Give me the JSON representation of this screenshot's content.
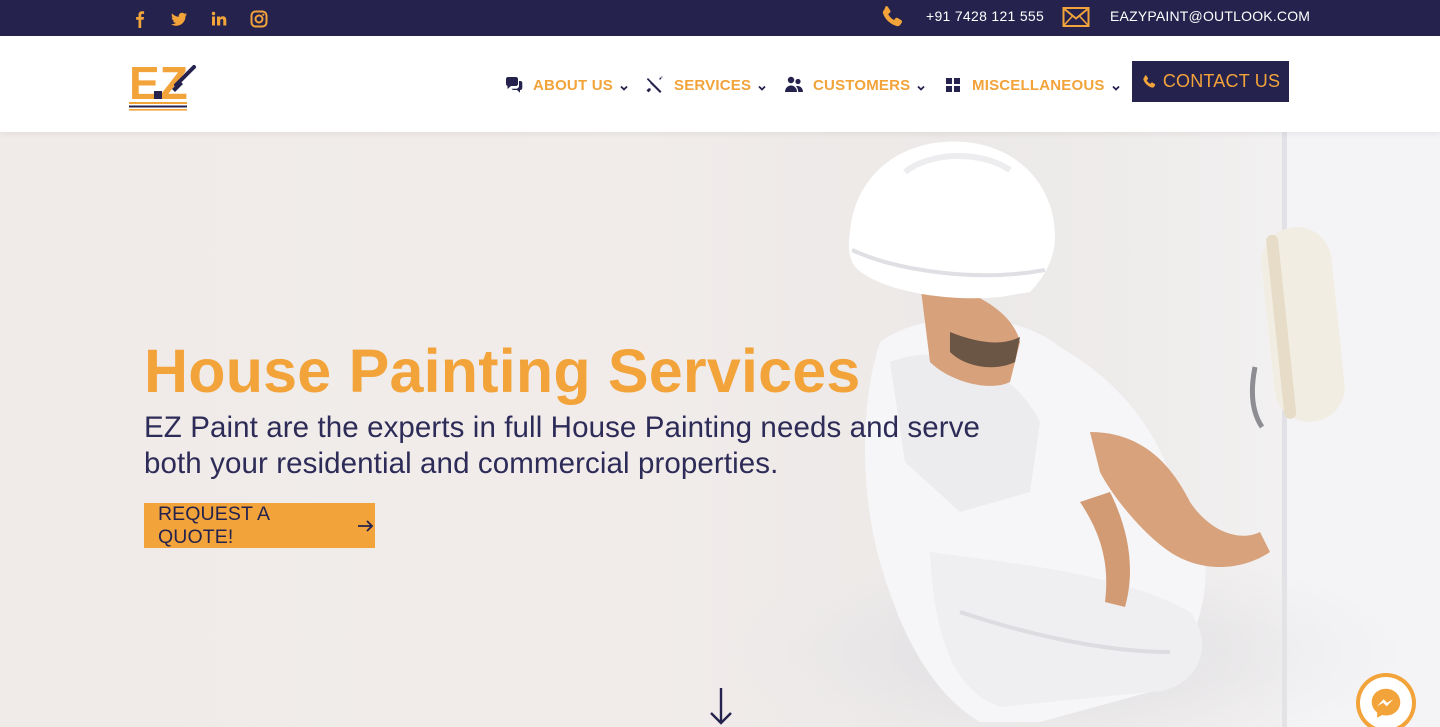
{
  "colors": {
    "navy": "#25234e",
    "orange": "#f2a33a",
    "text_dark": "#2d2b57",
    "white": "#ffffff"
  },
  "topbar": {
    "social_icons": [
      "facebook-icon",
      "twitter-icon",
      "linkedin-icon",
      "instagram-icon"
    ],
    "phone_icon": "phone-icon",
    "phone": "+91 7428 121 555",
    "mail_icon": "envelope-icon",
    "email": "EAZYPAINT@OUTLOOK.COM"
  },
  "header": {
    "logo_text": "EZ",
    "nav": [
      {
        "label": "ABOUT US",
        "icon": "chat-bubbles-icon"
      },
      {
        "label": "SERVICES",
        "icon": "tools-icon"
      },
      {
        "label": "CUSTOMERS",
        "icon": "users-icon"
      },
      {
        "label": "MISCELLANEOUS",
        "icon": "grid-icon"
      }
    ],
    "contact_button": {
      "label": "CONTACT US",
      "icon": "phone-icon"
    }
  },
  "hero": {
    "title": "House Painting Services",
    "subtitle": "EZ Paint are the experts in full House Painting needs and serve both your residential and commercial properties.",
    "cta": {
      "label": "REQUEST A QUOTE!",
      "icon": "arrow-right-icon"
    },
    "scroll_icon": "arrow-down-icon",
    "chat_widget_icon": "messenger-icon"
  }
}
